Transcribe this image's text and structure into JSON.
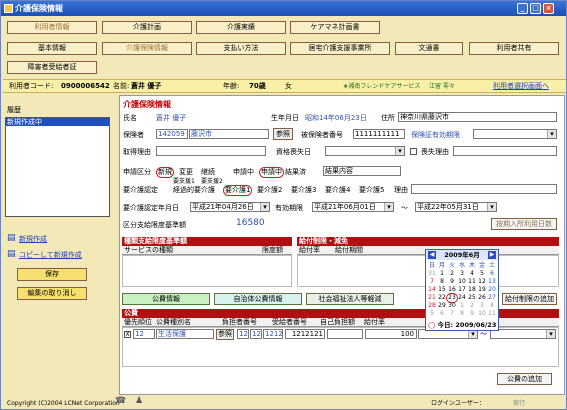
{
  "window": {
    "title": "介護保険情報",
    "min": "_",
    "max": "□",
    "close": "×"
  },
  "nav_row1": [
    {
      "label": "利用者情報"
    },
    {
      "label": "介護計画"
    },
    {
      "label": "介護実績"
    },
    {
      "label": "ケアマネ計画書"
    }
  ],
  "nav_row2": [
    {
      "label": "基本情報"
    },
    {
      "label": "介護保険情報"
    },
    {
      "label": "支払い方法"
    },
    {
      "label": "居宅介護支援事業所"
    },
    {
      "label": "文通書"
    },
    {
      "label": "利用者共有"
    }
  ],
  "nav_row3": [
    {
      "label": "障害者受給者証"
    }
  ],
  "infobar": {
    "code_label": "利用者コード:",
    "code": "0900006542",
    "name_label": "名前:",
    "name": "蒼井 優子",
    "age_label": "年齢:",
    "age": "70歳",
    "gender": "女",
    "facility": "★湘南フレンドケアサービス",
    "staff": "江留 零々",
    "back_link": "利用者選択画面へ"
  },
  "left": {
    "history_label": "履歴",
    "history_items": [
      "新規作成中"
    ],
    "new_link": "新規作成",
    "copy_link": "コピーして新規作成",
    "save": "保存",
    "cancel": "編集の取り消し"
  },
  "form": {
    "section_title": "介護保険情報",
    "name_label": "氏名",
    "name_value": "蒼井 優子",
    "birth_label": "生年月日",
    "birth_value": "昭和14年06月23日",
    "address_label": "住所",
    "address_value": "神奈川県藤沢市",
    "insurer_label": "保険者",
    "insurer_code": "142059",
    "insurer_name": "藤沢市",
    "ref_btn": "参照",
    "insured_no_label": "被保険者番号",
    "insured_no": "1111111111",
    "cert_period_label": "保険証有効期限",
    "acq_reason_label": "取得理由",
    "acq_date_label": "資格喪失日",
    "loss_reason_label": "喪失理由",
    "apply_label": "申請区分",
    "apply_opts": [
      "新規",
      "変更",
      "継続"
    ],
    "apply_mid_label": "申請中",
    "apply_mid_opts": [
      "申請中",
      "結果済"
    ],
    "result_label": "結果内容",
    "care_level_label": "要介護認定",
    "care_level_top": [
      "要支援1",
      "要支援2"
    ],
    "care_level_opts": [
      "経過的要介護",
      "要介護1",
      "要介護2",
      "要介護3",
      "要介護4",
      "要介護5"
    ],
    "reason_label": "理由",
    "cert_date_label": "要介護認定年月日",
    "cert_date": "平成21年04月26日",
    "valid_label": "有効期限",
    "valid_from": "平成21年06月01日",
    "tilde": "～",
    "valid_to": "平成22年05月31日",
    "limit_label": "区分支給限度基準額",
    "limit_value": "16580",
    "limit_btn": "按期入所利用日数",
    "limit_section": "種類支給限度基準額",
    "limit_cols": [
      "サービスの種類",
      "限度額"
    ],
    "benefit_section": "給付制限・減免",
    "benefit_cols": [
      "給付率",
      "給付期間"
    ],
    "benefit_add": "給付制限の追加",
    "tab_public": "公費情報",
    "tab_local": "自治体公費情報",
    "tab_welfare": "社会福祉法人等軽減",
    "public_section": "公費",
    "public_cols": [
      "優先順位",
      "公費種別名",
      "負担者番号",
      "受給者番号",
      "自己負担額",
      "給付率"
    ],
    "public_row": {
      "check": "X",
      "priority": "12",
      "name": "生活保護",
      "ref": "参照",
      "p1": "12",
      "p2": "12",
      "p3": "1212",
      "recipient": "1212121",
      "rate": "100"
    },
    "public_add": "公費の追加"
  },
  "calendar": {
    "title": "2009年6月",
    "prev": "◀",
    "next": "▶",
    "weekdays": [
      "日",
      "月",
      "火",
      "水",
      "木",
      "金",
      "土"
    ],
    "rows": [
      [
        "31",
        "1",
        "2",
        "3",
        "4",
        "5",
        "6"
      ],
      [
        "7",
        "8",
        "9",
        "10",
        "11",
        "12",
        "13"
      ],
      [
        "14",
        "15",
        "16",
        "17",
        "18",
        "19",
        "20"
      ],
      [
        "21",
        "22",
        "23",
        "24",
        "25",
        "26",
        "27"
      ],
      [
        "28",
        "29",
        "30",
        "1",
        "2",
        "3",
        "4"
      ],
      [
        "5",
        "6",
        "7",
        "8",
        "9",
        "10",
        "11"
      ]
    ],
    "today_label": "今日: 2009/06/23"
  },
  "status": {
    "copyright": "Copyright (C)2004 LCNet Corporation",
    "login_label": "ログインユーザー：",
    "exec": "実行"
  }
}
